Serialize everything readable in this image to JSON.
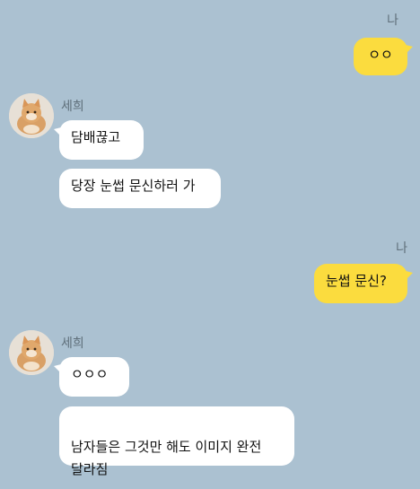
{
  "me": {
    "name": "나"
  },
  "friend": {
    "name": "세희",
    "avatar_icon": "cat-avatar-icon"
  },
  "colors": {
    "background": "#abc1d1",
    "incoming_bubble": "#ffffff",
    "outgoing_bubble": "#fbdc3e"
  },
  "messages": [
    {
      "from": "me",
      "text": "ㅇㅇ"
    },
    {
      "from": "friend",
      "text": "담배끊고"
    },
    {
      "from": "friend",
      "text": "당장 눈썹 문신하러 가"
    },
    {
      "from": "me",
      "text": "눈썹 문신?"
    },
    {
      "from": "friend",
      "text": "ㅇㅇㅇ"
    },
    {
      "from": "friend",
      "text": "남자들은 그것만 해도 이미지 완전\n달라짐"
    }
  ]
}
